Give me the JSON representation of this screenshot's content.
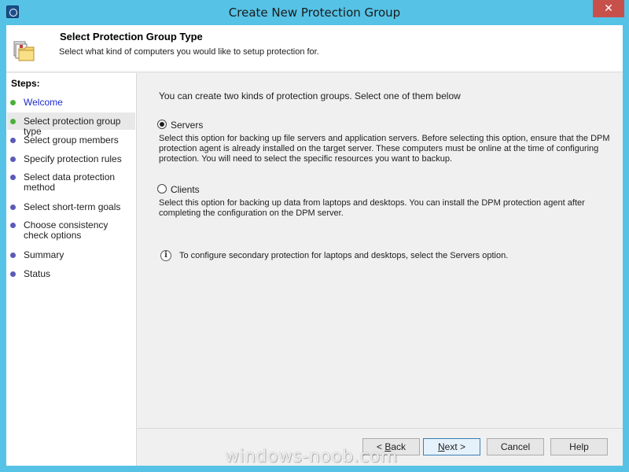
{
  "window": {
    "title": "Create New Protection Group",
    "close_glyph": "✕"
  },
  "header": {
    "title": "Select Protection Group Type",
    "subtitle": "Select what kind of computers you would like to setup protection for."
  },
  "steps": {
    "title": "Steps:",
    "items": [
      {
        "label": "Welcome",
        "status": "done"
      },
      {
        "label": "Select protection group type",
        "status": "current"
      },
      {
        "label": "Select group members",
        "status": "pending"
      },
      {
        "label": "Specify protection rules",
        "status": "pending"
      },
      {
        "label": "Select data protection method",
        "status": "pending"
      },
      {
        "label": "Select short-term goals",
        "status": "pending"
      },
      {
        "label": "Choose consistency check options",
        "status": "pending"
      },
      {
        "label": "Summary",
        "status": "pending"
      },
      {
        "label": "Status",
        "status": "pending"
      }
    ]
  },
  "main": {
    "intro": "You can create two kinds of protection groups. Select one of them below",
    "servers": {
      "label": "Servers",
      "selected": true,
      "description": "Select this option for backing up file servers and application servers. Before selecting this option, ensure that the DPM protection agent is already installed on the target server. These computers must be online at the time of configuring protection. You will need to select the specific resources you want to backup."
    },
    "clients": {
      "label": "Clients",
      "selected": false,
      "description": "Select this option for backing up data from laptops and desktops. You can install the DPM protection agent after completing the configuration on the DPM server."
    },
    "info": "To configure secondary protection for laptops and desktops, select the Servers option."
  },
  "buttons": {
    "back": {
      "prefix": "< ",
      "mnemonic": "B",
      "rest": "ack"
    },
    "next": {
      "mnemonic": "N",
      "rest": "ext >"
    },
    "cancel": "Cancel",
    "help": "Help"
  },
  "watermark": "windows-noob.com",
  "colors": {
    "titlebar": "#56c2e6",
    "close": "#c7504b",
    "link": "#1c2bd0",
    "step_done": "#4caf3d",
    "step_pending": "#5a5ab8"
  }
}
